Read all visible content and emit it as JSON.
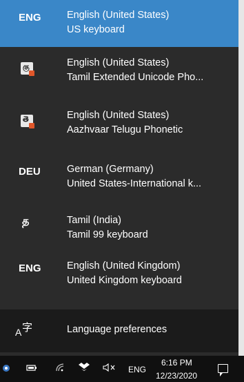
{
  "languages": [
    {
      "code": "ENG",
      "icon": "text",
      "line1": "English (United States)",
      "line2": "US keyboard",
      "selected": true
    },
    {
      "code": "",
      "icon": "tamil-extended-icon",
      "line1": "English (United States)",
      "line2": "Tamil Extended Unicode Pho...",
      "selected": false
    },
    {
      "code": "",
      "icon": "telugu-phonetic-icon",
      "line1": "English (United States)",
      "line2": "Aazhvaar Telugu Phonetic",
      "selected": false
    },
    {
      "code": "DEU",
      "icon": "text",
      "line1": "German (Germany)",
      "line2": "United States-International k...",
      "selected": false
    },
    {
      "code": "த",
      "icon": "tamil-char",
      "line1": "Tamil (India)",
      "line2": "Tamil 99 keyboard",
      "selected": false
    },
    {
      "code": "ENG",
      "icon": "text",
      "line1": "English (United Kingdom)",
      "line2": "United Kingdom keyboard",
      "selected": false
    }
  ],
  "preferences": {
    "label": "Language preferences",
    "icon_a": "A",
    "icon_z": "字"
  },
  "taskbar": {
    "language": "ENG",
    "time": "6:16 PM",
    "date": "12/23/2020"
  },
  "colors": {
    "accent": "#3a87c8",
    "flyout_bg": "#2b2b2b",
    "taskbar_bg": "#101010"
  }
}
